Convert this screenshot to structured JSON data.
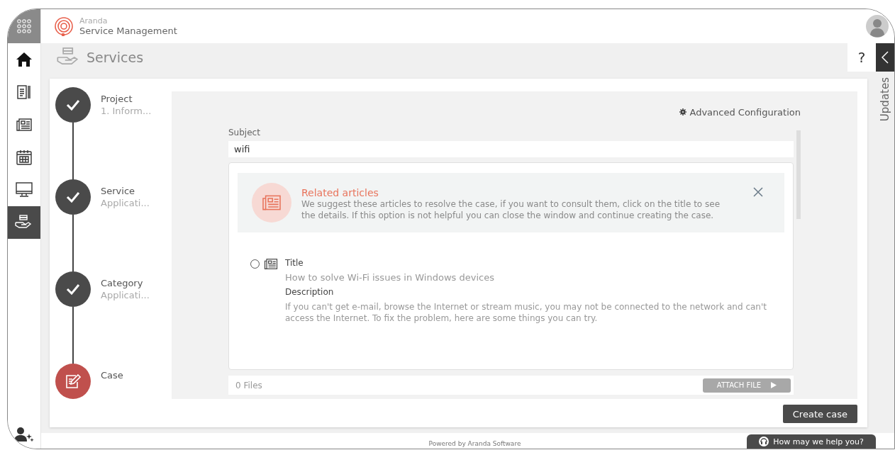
{
  "header": {
    "brand_top": "Aranda",
    "brand_bottom": "Service Management"
  },
  "nav": {
    "items": [
      {
        "kind": "home",
        "selected": false
      },
      {
        "kind": "document",
        "selected": false
      },
      {
        "kind": "news",
        "selected": false
      },
      {
        "kind": "calendar",
        "selected": false
      },
      {
        "kind": "monitor",
        "selected": false
      },
      {
        "kind": "services",
        "selected": true
      }
    ]
  },
  "page_title": "Services",
  "help": "?",
  "updates_tab": "Updates",
  "steps": [
    {
      "label": "Project",
      "subtitle": "1. Inform...",
      "kind": "done"
    },
    {
      "label": "Service",
      "subtitle": "Applicati...",
      "kind": "done"
    },
    {
      "label": "Category",
      "subtitle": "Applicati...",
      "kind": "done"
    },
    {
      "label": "Case",
      "kind": "current"
    }
  ],
  "advanced_config": "Advanced Configuration",
  "subject": {
    "label": "Subject",
    "value": "wifi"
  },
  "related": {
    "title": "Related articles",
    "message": "We suggest these articles to resolve the case, if you want to consult them, click on the title to see the details. If this option is not helpful you can close the window and continue creating the case."
  },
  "articles": [
    {
      "selected": false,
      "title_label": "Title",
      "title": "How to solve Wi-Fi issues in Windows devices",
      "description_label": "Description",
      "description": "If you can't get e-mail, browse the Internet or stream music, you may not be connected to the network and can't access the Internet. To fix the problem, here are some things you can try."
    }
  ],
  "files": {
    "count": "0 Files",
    "attach": "ATTACH FILE"
  },
  "create_button": "Create case",
  "footer": "Powered by Aranda Software",
  "help_button": "How may we help you?"
}
